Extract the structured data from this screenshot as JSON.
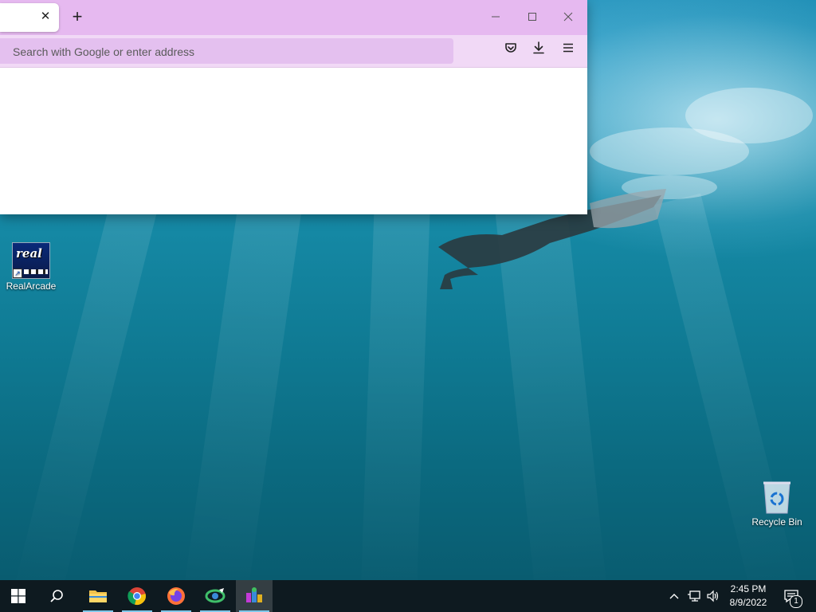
{
  "browser": {
    "tab": {
      "title": "",
      "close_icon": "close-icon"
    },
    "new_tab_icon": "plus-icon",
    "window_controls": {
      "minimize": "minimize-icon",
      "maximize": "maximize-icon",
      "close": "close-icon"
    },
    "address_bar": {
      "placeholder": "Search with Google or enter address",
      "value": ""
    },
    "toolbar": {
      "pocket": "pocket-icon",
      "downloads": "download-icon",
      "menu": "hamburger-menu-icon"
    },
    "theme": {
      "titlebar": "#e6b9f0",
      "navbar": "#f1d9f6",
      "urlbar": "#e4c0ef"
    }
  },
  "desktop": {
    "icons": [
      {
        "label": "RealArcade",
        "icon": "realarcade-icon"
      },
      {
        "label": "Recycle Bin",
        "icon": "recycle-bin-icon"
      }
    ]
  },
  "taskbar": {
    "start": "windows-start-icon",
    "search": "search-icon",
    "apps": [
      {
        "name": "File Explorer",
        "icon": "folder-icon",
        "active": true
      },
      {
        "name": "Google Chrome",
        "icon": "chrome-icon",
        "active": true
      },
      {
        "name": "Firefox",
        "icon": "firefox-icon",
        "active": true
      },
      {
        "name": "App",
        "icon": "app-icon",
        "active": true
      },
      {
        "name": "RealArcade",
        "icon": "realarcade-taskbar-icon",
        "active": true,
        "focused": true
      }
    ],
    "tray": {
      "chevron": "chevron-up-icon",
      "network": "network-icon",
      "volume": "volume-icon",
      "time": "2:45 PM",
      "date": "8/9/2022",
      "notifications": "notification-icon",
      "notification_count": "1"
    }
  }
}
